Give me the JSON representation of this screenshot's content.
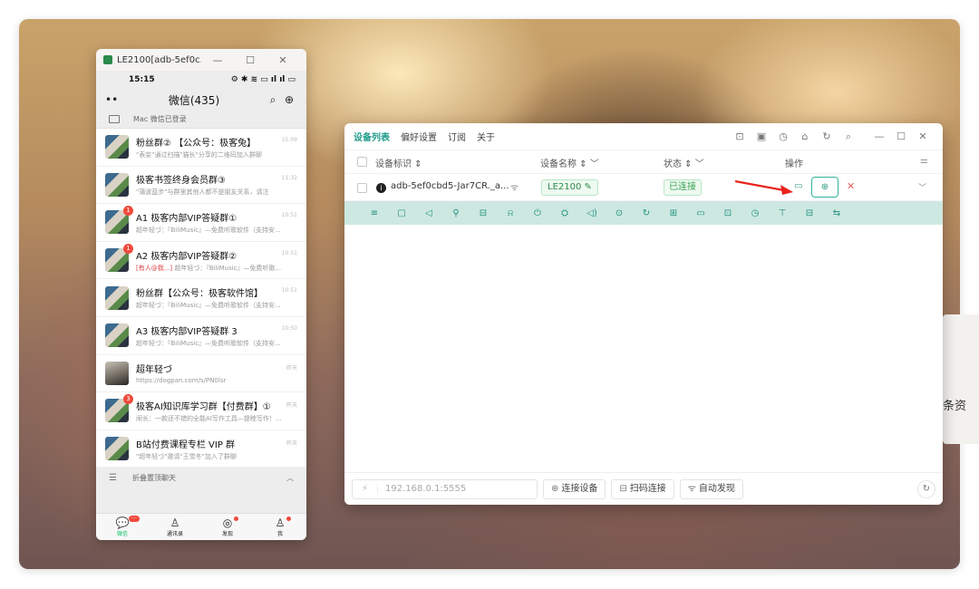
{
  "background_card": {
    "text": "条资"
  },
  "phone": {
    "window_title": "LE2100[adb-5ef0c...",
    "window_buttons": [
      "—",
      "☐",
      "✕"
    ],
    "status_time": "15:15",
    "status_icons": "⚙ ✱ ≋ ▭ ıl ıl ▭",
    "header_title": "微信(435)",
    "mac_login": "Mac 微信已登录",
    "chats": [
      {
        "name": "粉丝群② 【公众号：极客兔】",
        "preview": "\"表妄\"通过扫描\"猫长\"分享的二维码加入群聊",
        "time": "15:09",
        "badge": ""
      },
      {
        "name": "极客书签终身会员群③",
        "preview": "\"蒲波蓝步\"与群里其他人都不是朋友关系，请注",
        "time": "11:32",
        "badge": ""
      },
      {
        "name": "A1 极客内部VIP答疑群①",
        "preview": "超年轻づ：『BiliMusic』—免费听歌软件（支持安...",
        "time": "10:51",
        "badge": "1"
      },
      {
        "name": "A2 极客内部VIP答疑群②",
        "preview_at": "[有人@我...]",
        "preview": " 超年轻づ：『BiliMusic』—免费听歌...",
        "time": "10:51",
        "badge": "1"
      },
      {
        "name": "粉丝群【公众号：极客软件馆】",
        "preview": "超年轻づ：『BiliMusic』—免费听歌软件（支持安...",
        "time": "10:51",
        "badge": ""
      },
      {
        "name": "A3 极客内部VIP答疑群 3",
        "preview": "超年轻づ：『BiliMusic』—免费听歌软件（支持安...",
        "time": "10:50",
        "badge": ""
      },
      {
        "name": "超年轻づ",
        "preview": "https://dogpan.com/s/PN0lsr",
        "time": "昨天",
        "badge": "",
        "photo": true
      },
      {
        "name": "极客AI知识库学习群【付费群】①",
        "preview": "闹长：一款还不错的全能AI写作工具—提睦写作！...",
        "time": "昨天",
        "badge": "3"
      },
      {
        "name": "B站付费课程专栏 VIP 群",
        "preview": "\"超年轻づ\"邀请\"王雪冬\"加入了群聊",
        "time": "昨天",
        "badge": ""
      }
    ],
    "fold_label": "折叠置顶聊天",
    "tabs": [
      {
        "label": "微信",
        "icon": "💬",
        "badge": "···"
      },
      {
        "label": "通讯录",
        "icon": "♙",
        "badge": ""
      },
      {
        "label": "发现",
        "icon": "◎",
        "badge": ""
      },
      {
        "label": "我",
        "icon": "♙",
        "badge": ""
      }
    ]
  },
  "app": {
    "tabs": [
      "设备列表",
      "偏好设置",
      "订阅",
      "关于"
    ],
    "tool_icons": [
      "⊡",
      "▣",
      "◷",
      "⌂",
      "↻",
      "⌕"
    ],
    "window_buttons": [
      "—",
      "☐",
      "✕"
    ],
    "columns": {
      "id": "设备标识 ⇕",
      "name": "设备名称 ⇕ ﹀",
      "status": "状态 ⇕ ﹀",
      "ops": "操作",
      "settings": "⚌"
    },
    "device": {
      "id": "adb-5ef0cbd5-Jar7CR._a...",
      "wifi": "ᯤ",
      "name": "LE2100 ✎",
      "status": "已连接",
      "op_screen": "▭",
      "op_add": "⊕",
      "op_del": "✕",
      "expand": "﹀"
    },
    "toolbar_icons": [
      "≡",
      "▢",
      "◁",
      "⚲",
      "⊟",
      "⍾",
      "⏻",
      "⛭",
      "◁)",
      "⊙",
      "↻",
      "⊞",
      "▭",
      "⊡",
      "◷",
      "⊤",
      "⊟",
      "⇆"
    ],
    "ip_placeholder": "192.168.0.1:5555",
    "ip_prefix": "⚡",
    "buttons": [
      {
        "icon": "⊕",
        "label": "连接设备"
      },
      {
        "icon": "⊟",
        "label": "扫码连接"
      },
      {
        "icon": "ᯤ",
        "label": "自动发现"
      }
    ],
    "refresh_icon": "↻"
  }
}
